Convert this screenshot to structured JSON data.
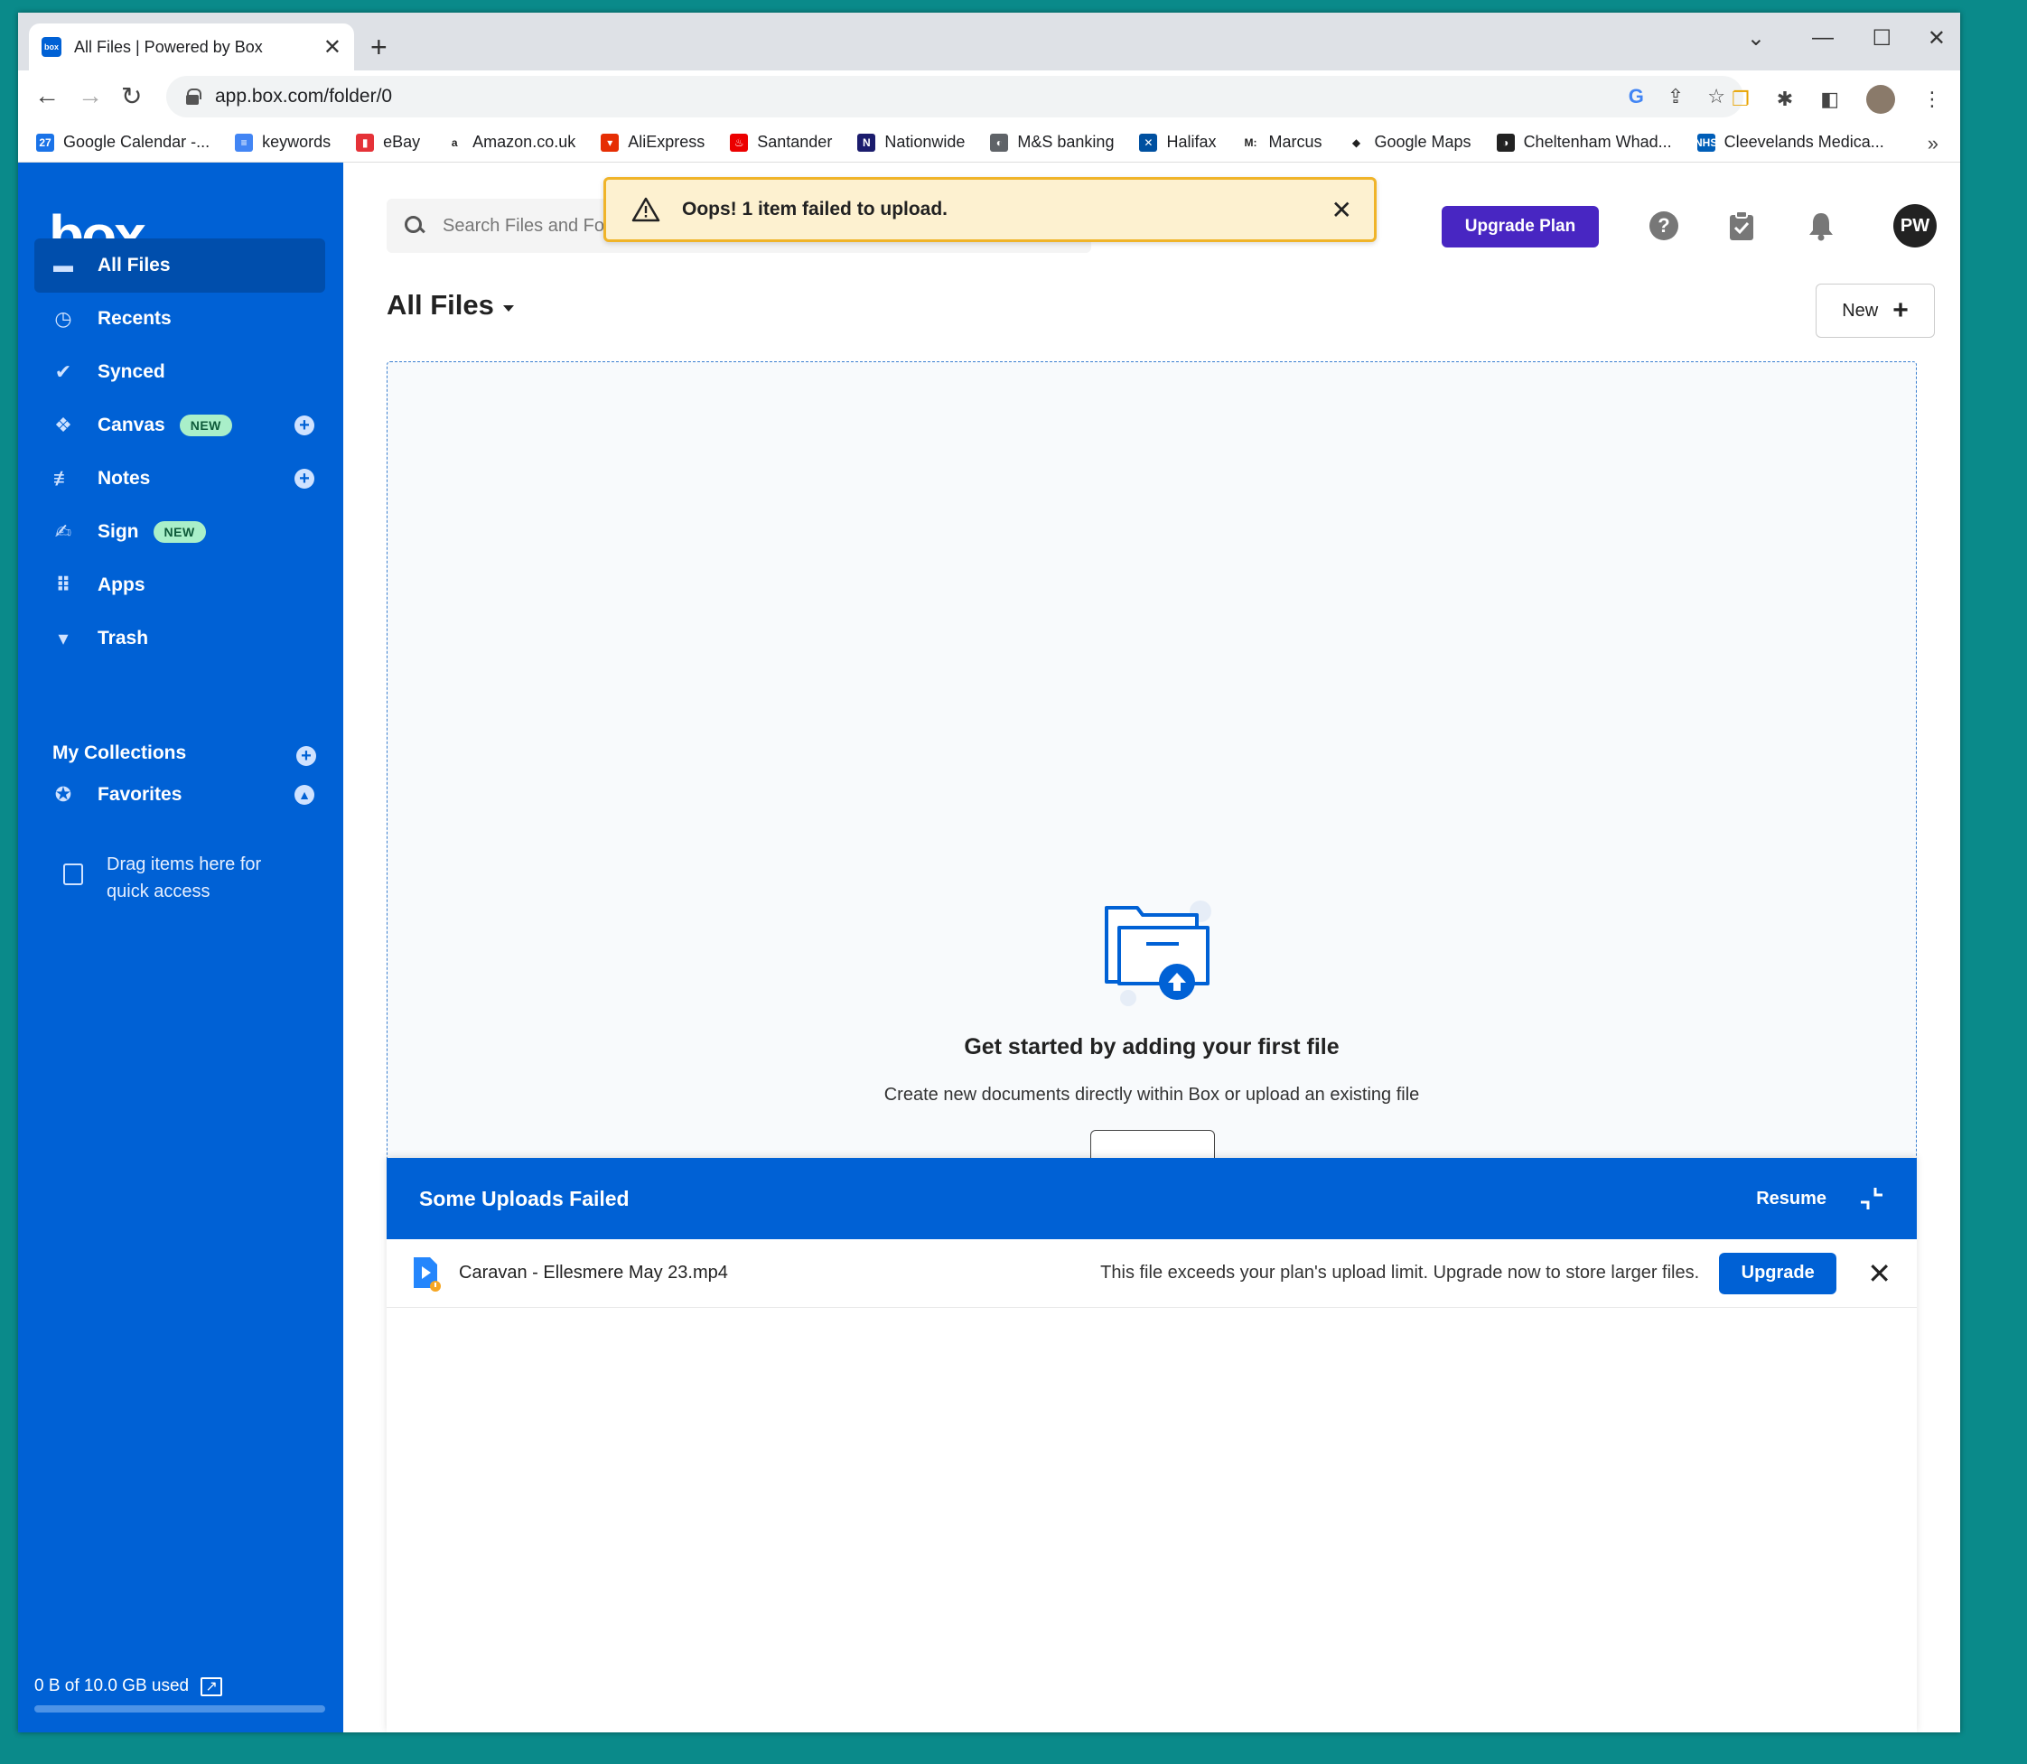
{
  "browser": {
    "tab_title": "All Files | Powered by Box",
    "tab_favicon": "box",
    "url": "app.box.com/folder/0",
    "bookmarks": [
      {
        "label": "Google Calendar -...",
        "icon": "calendar-icon",
        "color": "#1a73e8",
        "glyph": "27"
      },
      {
        "label": "keywords",
        "icon": "docs-icon",
        "color": "#4285f4",
        "glyph": "≡"
      },
      {
        "label": "eBay",
        "icon": "ebay-icon",
        "color": "#e53238",
        "glyph": "▮"
      },
      {
        "label": "Amazon.co.uk",
        "icon": "amazon-icon",
        "color": "#ffffff",
        "glyph": "a"
      },
      {
        "label": "AliExpress",
        "icon": "aliexpress-icon",
        "color": "#e62e04",
        "glyph": "▾"
      },
      {
        "label": "Santander",
        "icon": "santander-icon",
        "color": "#ec0000",
        "glyph": "♨"
      },
      {
        "label": "Nationwide",
        "icon": "nationwide-icon",
        "color": "#1b1c6d",
        "glyph": "N"
      },
      {
        "label": "M&S banking",
        "icon": "globe-icon",
        "color": "#5f6368",
        "glyph": "◐"
      },
      {
        "label": "Halifax",
        "icon": "halifax-icon",
        "color": "#0050a0",
        "glyph": "✕"
      },
      {
        "label": "Marcus",
        "icon": "marcus-icon",
        "color": "#ffffff",
        "glyph": "M:"
      },
      {
        "label": "Google Maps",
        "icon": "maps-icon",
        "color": "#ffffff",
        "glyph": "◆"
      },
      {
        "label": "Cheltenham Whad...",
        "icon": "cheltenham-icon",
        "color": "#222222",
        "glyph": "◑"
      },
      {
        "label": "Cleevelands Medica...",
        "icon": "nhs-icon",
        "color": "#005eb8",
        "glyph": "NHS"
      }
    ],
    "more": "»"
  },
  "sidebar": {
    "logo": "box",
    "items": [
      {
        "label": "All Files",
        "icon": "folder-icon",
        "glyph": "▬",
        "active": true
      },
      {
        "label": "Recents",
        "icon": "clock-icon",
        "glyph": "◷"
      },
      {
        "label": "Synced",
        "icon": "check-circle-icon",
        "glyph": "✔"
      },
      {
        "label": "Canvas",
        "icon": "canvas-icon",
        "glyph": "❖",
        "badge": "NEW",
        "add": true
      },
      {
        "label": "Notes",
        "icon": "notes-icon",
        "glyph": "≢",
        "add": true
      },
      {
        "label": "Sign",
        "icon": "signature-icon",
        "glyph": "✍",
        "badge": "NEW"
      },
      {
        "label": "Apps",
        "icon": "apps-grid-icon",
        "glyph": "⠿"
      },
      {
        "label": "Trash",
        "icon": "trash-icon",
        "glyph": "▾"
      }
    ],
    "collections_title": "My Collections",
    "favorites_label": "Favorites",
    "drag_hint": "Drag items here for quick access",
    "storage_text": "0 B of 10.0 GB used",
    "storage_used_fraction": 0.0
  },
  "header": {
    "search_placeholder": "Search Files and Folders",
    "upgrade_plan": "Upgrade Plan",
    "avatar_initials": "PW"
  },
  "toast": {
    "message": "Oops! 1 item failed to upload."
  },
  "main": {
    "title": "All Files",
    "new_button": "New",
    "empty_title": "Get started by adding your first file",
    "empty_subtitle": "Create new documents directly within Box or upload an existing file"
  },
  "upload_panel": {
    "title": "Some Uploads Failed",
    "resume": "Resume",
    "items": [
      {
        "file_name": "Caravan - Ellesmere May 23.mp4",
        "message": "This file exceeds your plan's upload limit. Upgrade now to store larger files.",
        "action": "Upgrade"
      }
    ]
  },
  "colors": {
    "box_blue": "#0061d5",
    "upgrade_purple": "#4826c2",
    "toast_bg": "#fdf1d0",
    "toast_border": "#f0b429",
    "desktop": "#0a8a8a"
  }
}
